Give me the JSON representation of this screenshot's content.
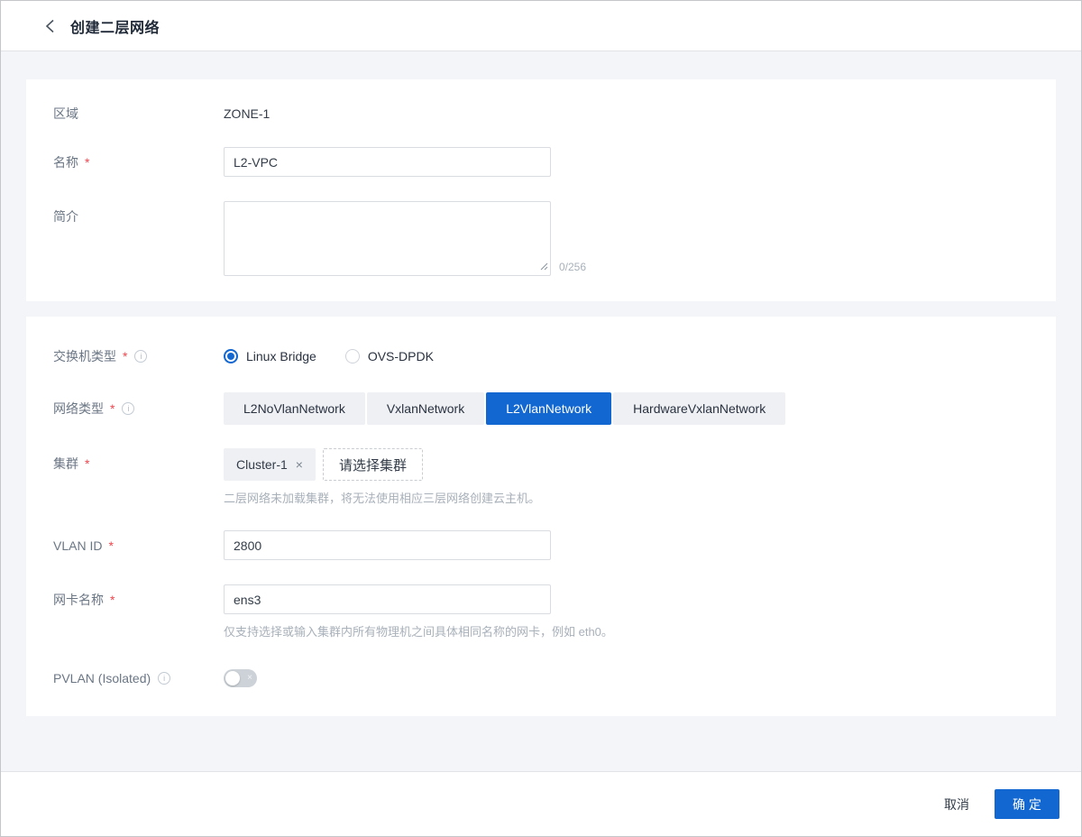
{
  "header": {
    "title": "创建二层网络"
  },
  "section_basic": {
    "zone": {
      "label": "区域",
      "value": "ZONE-1"
    },
    "name": {
      "label": "名称",
      "required_mark": "*",
      "value": "L2-VPC"
    },
    "description": {
      "label": "简介",
      "value": "",
      "counter": "0/256"
    }
  },
  "section_network": {
    "switch_type": {
      "label": "交换机类型",
      "required_mark": "*",
      "info_mark": "i",
      "options": [
        "Linux Bridge",
        "OVS-DPDK"
      ],
      "selected": "Linux Bridge"
    },
    "network_type": {
      "label": "网络类型",
      "required_mark": "*",
      "info_mark": "i",
      "options": [
        "L2NoVlanNetwork",
        "VxlanNetwork",
        "L2VlanNetwork",
        "HardwareVxlanNetwork"
      ],
      "selected": "L2VlanNetwork"
    },
    "cluster": {
      "label": "集群",
      "required_mark": "*",
      "tag": "Cluster-1",
      "tag_remove": "×",
      "select_button": "请选择集群",
      "help": "二层网络未加载集群，将无法使用相应三层网络创建云主机。"
    },
    "vlan_id": {
      "label": "VLAN ID",
      "required_mark": "*",
      "value": "2800"
    },
    "nic_name": {
      "label": "网卡名称",
      "required_mark": "*",
      "value": "ens3",
      "help": "仅支持选择或输入集群内所有物理机之间具体相同名称的网卡，例如 eth0。"
    },
    "pvlan": {
      "label": "PVLAN (Isolated)",
      "info_mark": "i",
      "state": "off",
      "off_mark": "×"
    }
  },
  "footer": {
    "cancel_label": "取消",
    "confirm_label": "确 定"
  },
  "colors": {
    "primary": "#1267d1",
    "danger": "#f0454d",
    "page_background": "#f3f5f9"
  }
}
